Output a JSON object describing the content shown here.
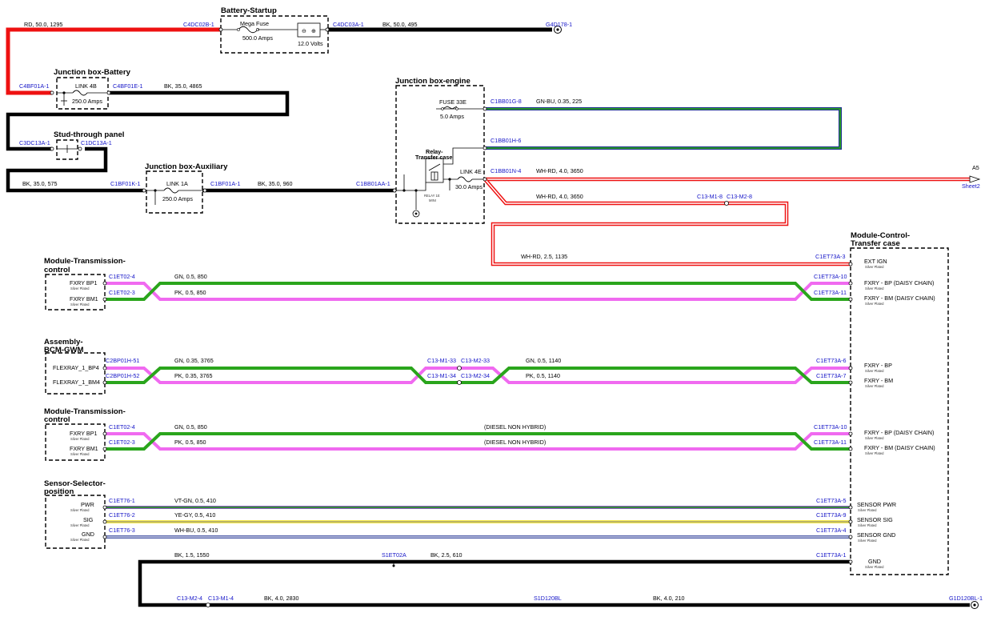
{
  "colors": {
    "BK": "#000000",
    "RD": "#ee1111",
    "GN": "#2aa51c",
    "PK": "#f06af0",
    "BU": "#1c2f8f",
    "YE": "#f0e010",
    "WH": "#ffffff",
    "VT": "#5e2ca0",
    "GY": "#9a9a9a",
    "connector_label": "#1515c8"
  },
  "titles": {
    "battery_startup": "Battery-Startup",
    "jb_battery": "Junction box-Battery",
    "stud_through": "Stud-through panel",
    "jb_auxiliary": "Junction box-Auxiliary",
    "jb_engine": "Junction box-engine",
    "tcm1_a": "Module-Transmission-",
    "tcm1_b": "control",
    "bcm_a": "Assembly-",
    "bcm_b": "BCM-GWM",
    "tcm2_a": "Module-Transmission-",
    "tcm2_b": "control",
    "sensor_a": "Sensor-Selector-",
    "sensor_b": "position",
    "tcase_a": "Module-Control-",
    "tcase_b": "Transfer case"
  },
  "components": {
    "mega_fuse": "Mega Fuse",
    "mega_fuse_rating": "500.0 Amps",
    "battery_volts": "12.0 Volts",
    "link4b": "LINK 4B",
    "link4b_rating": "250.0 Amps",
    "link1a": "LINK 1A",
    "link1a_rating": "250.0 Amps",
    "fuse33e": "FUSE 33E",
    "fuse33e_rating": "5.0 Amps",
    "relay_a": "Relay-",
    "relay_b": "Transfer case",
    "relay_sub_a": "RELAY 1E",
    "relay_sub_b": "MINI",
    "link4e": "LINK 4E",
    "link4e_rating": "30.0 Amps"
  },
  "connectors": {
    "c4dc02b": "C4DC02B-1",
    "c4dc03a": "C4DC03A-1",
    "g4d178": "G4D178-1",
    "c4bf01a": "C4BF01A-1",
    "c4bf01e": "C4BF01E-1",
    "c3dc13a": "C3DC13A-1",
    "c1dc13a": "C1DC13A-1",
    "c1bf01k": "C1BF01K-1",
    "c1bf01a": "C1BF01A-1",
    "c1bb01aa": "C1BB01AA-1",
    "c1bb01g": "C1BB01G-8",
    "c1bb01h": "C1BB01H-6",
    "c1bb01n": "C1BB01N-4",
    "a5": "A5",
    "sheet2": "Sheet2",
    "c13m18": "C13-M1-8",
    "c13m28": "C13-M2-8",
    "tc_a3": "C1ET73A-3",
    "tcm_p4": "C1ET02-4",
    "tcm_p3": "C1ET02-3",
    "tc_a10": "C1ET73A-10",
    "tc_a11": "C1ET73A-11",
    "bcm_51": "C2BP01H-51",
    "bcm_52": "C2BP01H-52",
    "m133": "C13-M1-33",
    "m233": "C13-M2-33",
    "m134": "C13-M1-34",
    "m234": "C13-M2-34",
    "tc_a6": "C1ET73A-6",
    "tc_a7": "C1ET73A-7",
    "s761": "C1ET76-1",
    "s762": "C1ET76-2",
    "s763": "C1ET76-3",
    "tc_a5": "C1ET73A-5",
    "tc_a9": "C1ET73A-9",
    "tc_a4": "C1ET73A-4",
    "tc_a1": "C1ET73A-1",
    "s1et02a": "S1ET02A",
    "m24": "C13-M2-4",
    "m14": "C13-M1-4",
    "s1d120bl": "S1D120BL",
    "g1d120bl": "G1D120BL-1"
  },
  "wires": {
    "w_rd_50": "RD,  50.0,  1295",
    "w_bk_50": "BK,  50.0,  495",
    "w_bk_35_4865": "BK,  35.0,  4865",
    "w_bk_35_575": "BK,  35.0,  575",
    "w_bk_35_960": "BK,  35.0,  960",
    "w_gnbu": "GN-BU,  0.35,  225",
    "w_whrd_4a": "WH-RD,  4.0,  3650",
    "w_whrd_4b": "WH-RD,  4.0,  3650",
    "w_whrd_25": "WH-RD,  2.5,  1135",
    "w_gn_05_850a": "GN,  0.5,  850",
    "w_pk_05_850a": "PK,  0.5,  850",
    "w_gn_035": "GN,  0.35,  3765",
    "w_pk_035": "PK,  0.35,  3765",
    "w_gn_1140": "GN,  0.5,  1140",
    "w_pk_1140": "PK,  0.5,  1140",
    "w_gn_05_850b": "GN,  0.5,  850",
    "w_pk_05_850b": "PK,  0.5,  850",
    "diesel_a": "(DIESEL NON HYBRID)",
    "diesel_b": "(DIESEL NON HYBRID)",
    "w_vtgn": "VT-GN,  0.5,  410",
    "w_yegy": "YE-GY,  0.5,  410",
    "w_whbu": "WH-BU,  0.5,  410",
    "w_bk_15": "BK,  1.5,  1550",
    "w_bk_25_610": "BK,  2.5,  610",
    "w_bk_4_2830": "BK,  4.0,  2830",
    "w_bk_4_210": "BK,  4.0,  210"
  },
  "pins": {
    "tcm1_bp1": "FXRY BP1",
    "tcm1_bm1": "FXRY BM1",
    "bcm_bp4": "FLEXRAY_1_BP4",
    "bcm_bm4": "FLEXRAY_1_BM4",
    "tcm2_bp1": "FXRY BP1",
    "tcm2_bm1": "FXRY BM1",
    "pwr": "PWR",
    "sig": "SIG",
    "gnd": "GND",
    "ext_ign": "EXT IGN",
    "fxry_bp_dc1": "FXRY - BP (DAISY CHAIN)",
    "fxry_bm_dc1": "FXRY - BM (DAISY CHAIN)",
    "fxry_bp": "FXRY - BP",
    "fxry_bm": "FXRY - BM",
    "fxry_bp_dc2": "FXRY - BP (DAISY CHAIN)",
    "fxry_bm_dc2": "FXRY - BM (DAISY CHAIN)",
    "sensor_pwr": "SENSOR PWR",
    "sensor_sig": "SENSOR SIG",
    "sensor_gnd": "SENSOR GND",
    "tc_gnd": "GND",
    "silver": "Silver Plated"
  }
}
